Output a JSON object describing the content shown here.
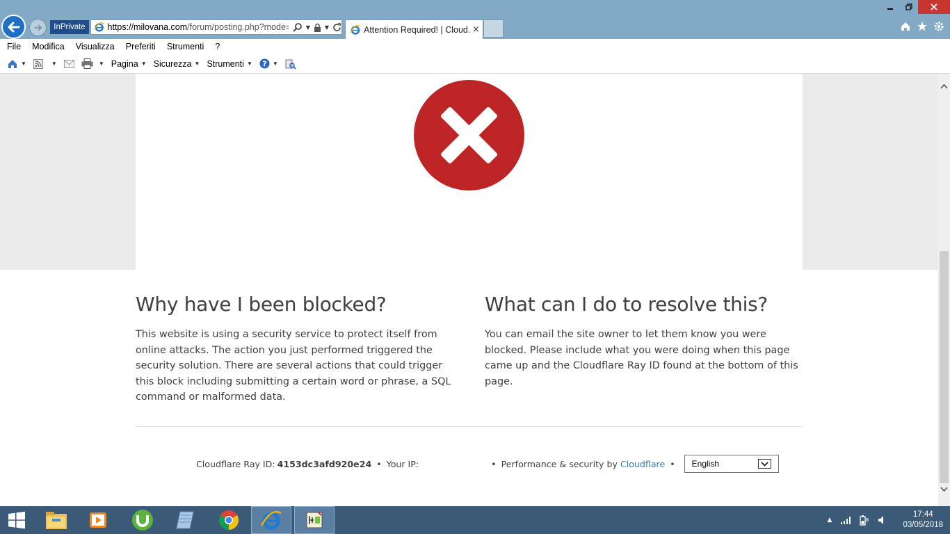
{
  "browser": {
    "inprivate_label": "InPrivate",
    "address": {
      "host": "https://milovana.com",
      "path": "/forum/posting.php?mode="
    },
    "tab_title": "Attention Required! | Cloud...",
    "tab_close": "×"
  },
  "menubar": [
    "File",
    "Modifica",
    "Visualizza",
    "Preferiti",
    "Strumenti",
    "?"
  ],
  "commandbar": {
    "page": "Pagina",
    "security": "Sicurezza",
    "tools": "Strumenti"
  },
  "page": {
    "left": {
      "title": "Why have I been blocked?",
      "body": "This website is using a security service to protect itself from online attacks. The action you just performed triggered the security solution. There are several actions that could trigger this block including submitting a certain word or phrase, a SQL command or malformed data."
    },
    "right": {
      "title": "What can I do to resolve this?",
      "body": "You can email the site owner to let them know you were blocked. Please include what you were doing when this page came up and the Cloudflare Ray ID found at the bottom of this page."
    },
    "footer": {
      "ray_label": "Cloudflare Ray ID:",
      "ray_id": "4153dc3afd920e24",
      "sep": "•",
      "ip_label": "Your IP:",
      "perf_label": "Performance & security by",
      "cloudflare_link": "Cloudflare",
      "language": "English"
    }
  },
  "taskbar": {
    "time": "17:44",
    "date": "03/05/2018"
  },
  "colors": {
    "error_red": "#bd2426",
    "link_blue": "#2f7bbf",
    "chrome_blue": "#82aac6",
    "taskbar": "#3a5a78"
  }
}
